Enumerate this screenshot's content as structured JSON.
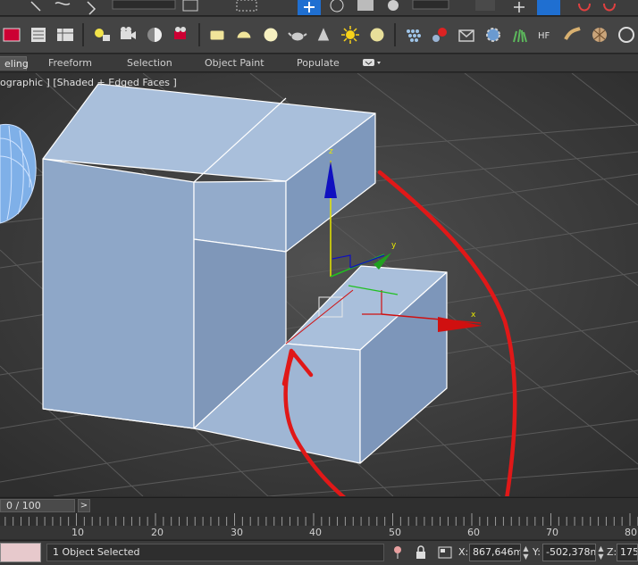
{
  "ribbon": {
    "tabs": [
      "eling",
      "Freeform",
      "Selection",
      "Object Paint",
      "Populate"
    ]
  },
  "viewport": {
    "label": "ographic ] [Shaded + Edged Faces ]",
    "gizmo_axes": {
      "x": "x",
      "y": "y",
      "z": "z"
    }
  },
  "timeline": {
    "frame_display": "0 / 100",
    "next_button": ">"
  },
  "ruler": {
    "labels": [
      "10",
      "20",
      "30",
      "40",
      "50",
      "60",
      "70",
      "80"
    ]
  },
  "status_bar": {
    "status_text": "1 Object Selected",
    "x_label": "X:",
    "x_value": "867,646mr",
    "y_label": "Y:",
    "y_value": "-502,378m",
    "z_label": "Z:",
    "z_value": "175,"
  },
  "colors": {
    "accent_active": "#1f6fd1",
    "selection_red": "#e0141c",
    "object_fill": "#a6bcd8"
  }
}
